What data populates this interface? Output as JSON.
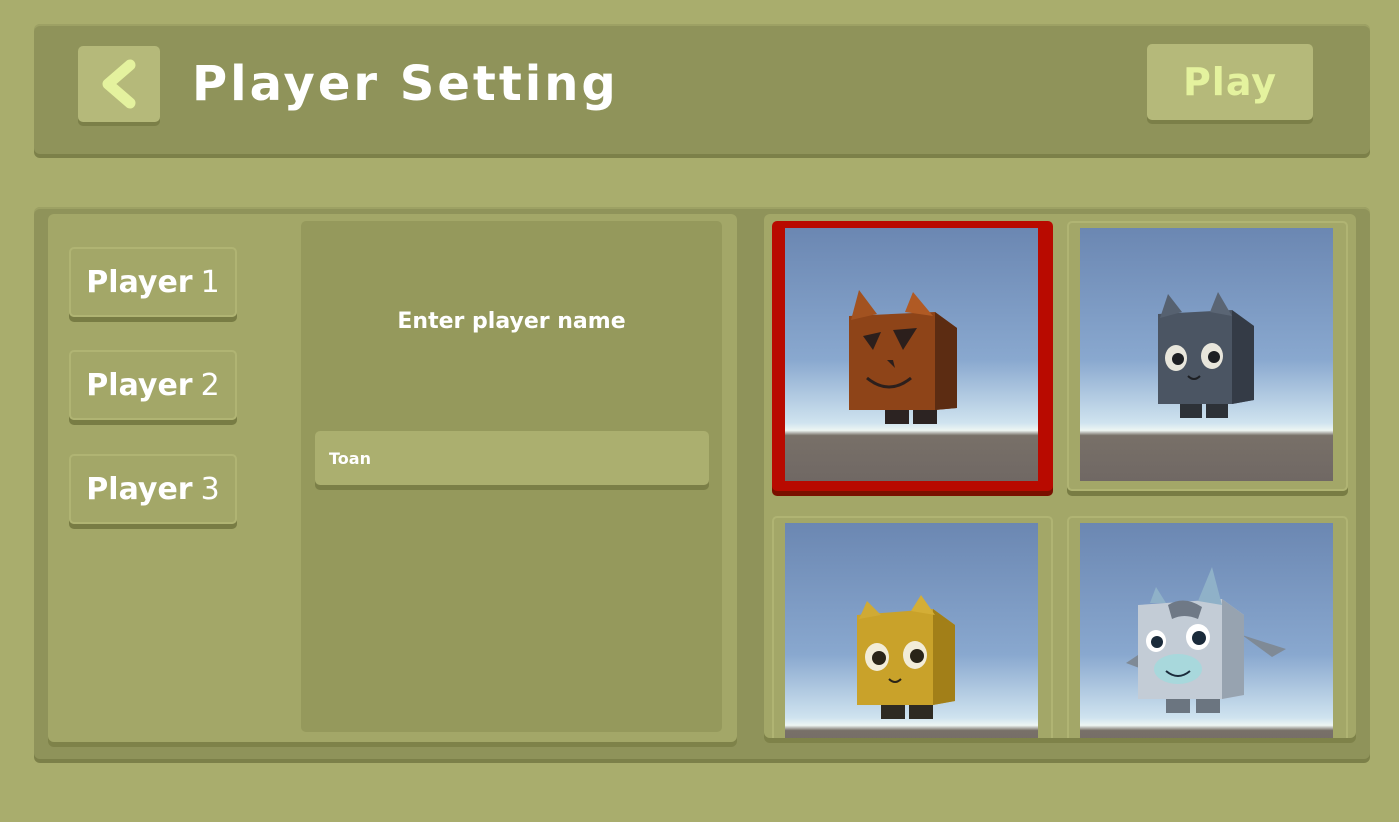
{
  "header": {
    "title": "Player Setting",
    "play_label": "Play",
    "back_icon": "chevron-left-icon"
  },
  "players": [
    {
      "label": "Player",
      "number": "1"
    },
    {
      "label": "Player",
      "number": "2"
    },
    {
      "label": "Player",
      "number": "3"
    }
  ],
  "name_panel": {
    "label": "Enter player name",
    "input_value": "Toan"
  },
  "characters": [
    {
      "name": "pumpkin-cat",
      "selected": true
    },
    {
      "name": "dark-gray-cat",
      "selected": false
    },
    {
      "name": "yellow-cat",
      "selected": false
    },
    {
      "name": "gray-dragon-cow",
      "selected": false
    }
  ],
  "colors": {
    "background": "#a9ad6d",
    "panel": "#8f935a",
    "button": "#b5b97a",
    "play_text": "#e4f29e",
    "selected_border": "#b80a00"
  }
}
